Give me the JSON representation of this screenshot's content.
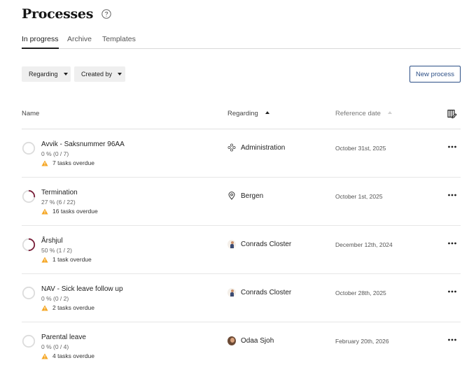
{
  "header": {
    "title": "Processes"
  },
  "tabs": [
    {
      "label": "In progress",
      "active": true
    },
    {
      "label": "Archive",
      "active": false
    },
    {
      "label": "Templates",
      "active": false
    }
  ],
  "filters": {
    "regarding_label": "Regarding",
    "created_by_label": "Created by"
  },
  "actions": {
    "new_process_label": "New process"
  },
  "columns": {
    "name": "Name",
    "regarding": "Regarding",
    "reference_date": "Reference date"
  },
  "colors": {
    "accent": "#2c4f86",
    "progress": "#7a1f3a",
    "warning": "#f5a623",
    "ring_track": "#dcdcdc"
  },
  "rows": [
    {
      "name": "Avvik - Saksnummer 96AA",
      "progress": "0 % (0 / 7)",
      "progress_fraction": 0,
      "overdue": "7 tasks overdue",
      "regarding": "Administration",
      "regarding_icon": "org-icon",
      "date": "October 31st, 2025"
    },
    {
      "name": "Termination",
      "progress": "27 % (6 / 22)",
      "progress_fraction": 0.27,
      "overdue": "16 tasks overdue",
      "regarding": "Bergen",
      "regarding_icon": "location-pin-icon",
      "date": "October 1st, 2025"
    },
    {
      "name": "Årshjul",
      "progress": "50 % (1 / 2)",
      "progress_fraction": 0.5,
      "overdue": "1 task overdue",
      "regarding": "Conrads Closter",
      "regarding_icon": "avatar-person",
      "date": "December 12th, 2024"
    },
    {
      "name": "NAV - Sick leave follow up",
      "progress": "0 % (0 / 2)",
      "progress_fraction": 0,
      "overdue": "2 tasks overdue",
      "regarding": "Conrads Closter",
      "regarding_icon": "avatar-person",
      "date": "October 28th, 2025"
    },
    {
      "name": "Parental leave",
      "progress": "0 % (0 / 4)",
      "progress_fraction": 0,
      "overdue": "4 tasks overdue",
      "regarding": "Odaa Sjoh",
      "regarding_icon": "avatar-photo",
      "date": "February 20th, 2026"
    }
  ]
}
